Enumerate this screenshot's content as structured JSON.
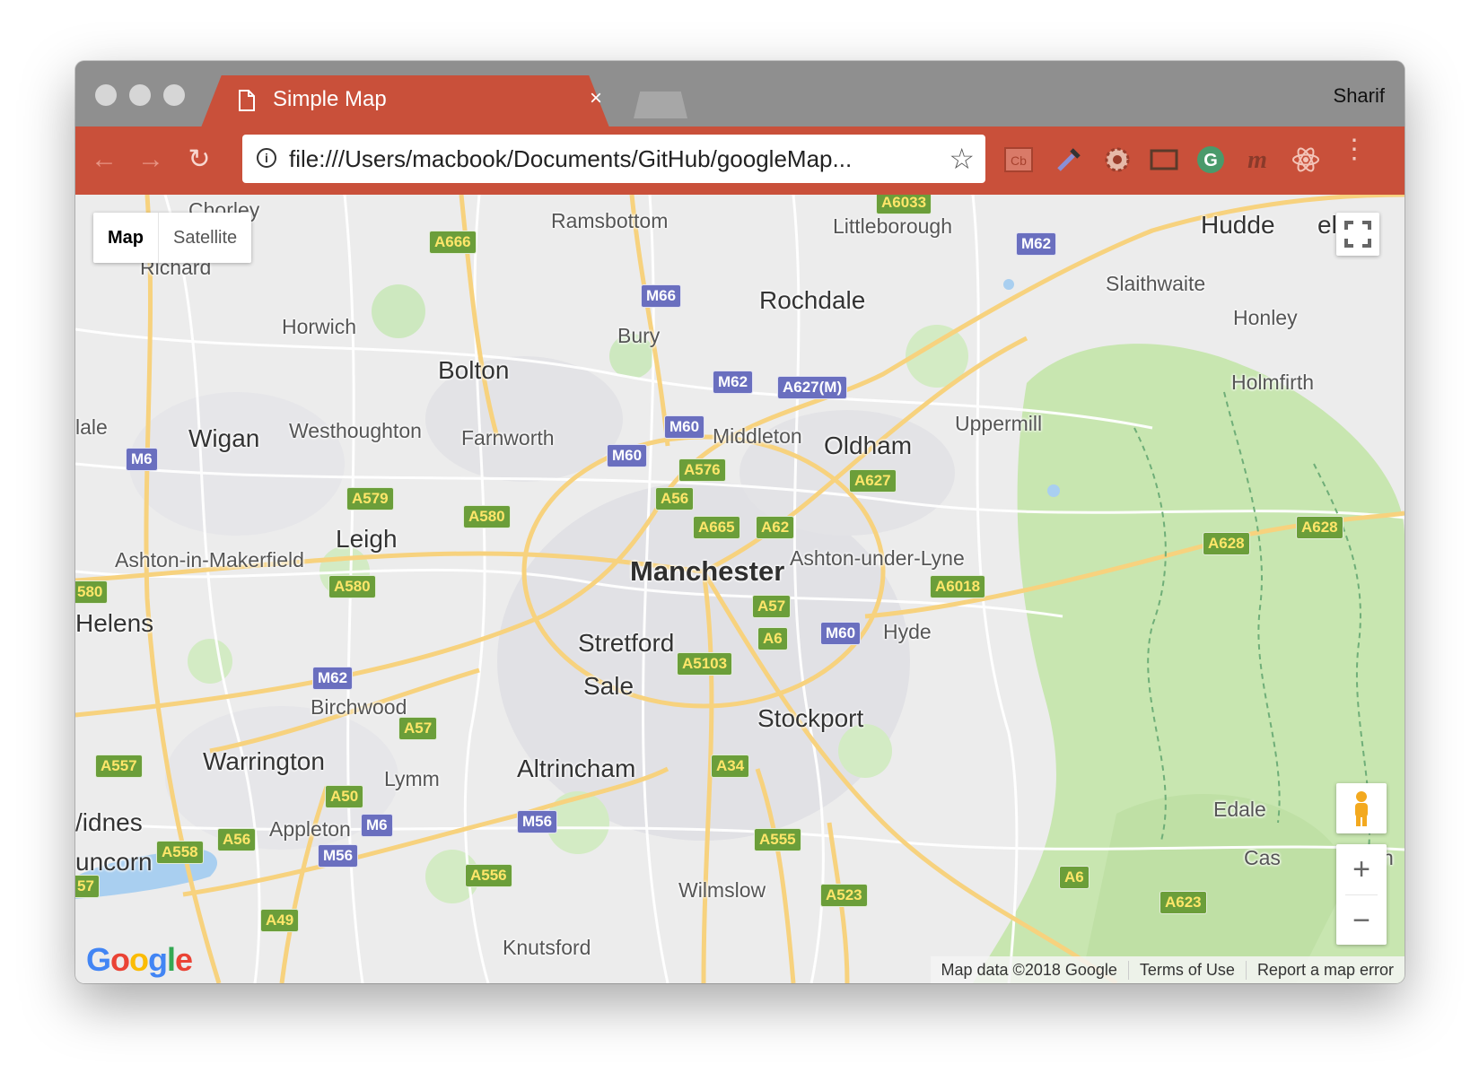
{
  "browser": {
    "tab_title": "Simple Map",
    "tab_close": "×",
    "profile_name": "Sharif",
    "url": "file:///Users/macbook/Documents/GitHub/googleMap...",
    "extensions": [
      "cb-extension-icon",
      "eyedropper-icon",
      "gear-extension-icon",
      "window-resizer-icon",
      "grammarly-icon",
      "m-extension-icon",
      "react-devtools-icon"
    ],
    "accent_color": "#c9503a"
  },
  "map": {
    "type_controls": [
      "Map",
      "Satellite"
    ],
    "selected_type": "Map",
    "zoom_in": "+",
    "zoom_out": "−",
    "logo": "Google",
    "attribution": [
      "Map data ©2018 Google",
      "Terms of Use",
      "Report a map error"
    ],
    "places": {
      "chorley": "Chorley",
      "richard": "Richard",
      "ramsbottom": "Ramsbottom",
      "littleborough": "Littleborough",
      "hudde": "Hudde",
      "el": "el",
      "rochdale": "Rochdale",
      "slaithwaite": "Slaithwaite",
      "horwich": "Horwich",
      "bury": "Bury",
      "honley": "Honley",
      "bolton": "Bolton",
      "holmfirth": "Holmfirth",
      "dale": "lale",
      "wigan": "Wigan",
      "westhoughton": "Westhoughton",
      "farnworth": "Farnworth",
      "middleton": "Middleton",
      "oldham": "Oldham",
      "uppermill": "Uppermill",
      "leigh": "Leigh",
      "ashton_makerfield": "Ashton-in-Makerfield",
      "manchester": "Manchester",
      "ashton_lyne": "Ashton-under-Lyne",
      "helens": "Helens",
      "stretford": "Stretford",
      "hyde": "Hyde",
      "sale": "Sale",
      "birchwood": "Birchwood",
      "stockport": "Stockport",
      "warrington": "Warrington",
      "lymm": "Lymm",
      "altrincham": "Altrincham",
      "widnes": "/idnes",
      "edale": "Edale",
      "appleton": "Appleton",
      "runcorn": "uncorn",
      "castleton": "Cas",
      "castleton_end": "n",
      "wilmslow": "Wilmslow",
      "knutsford": "Knutsford"
    },
    "roads": {
      "a6033": "A6033",
      "a666": "A666",
      "m62_ne": "M62",
      "m66": "M66",
      "m62_n": "M62",
      "a627m": "A627(M)",
      "m60_n": "M60",
      "m6_w": "M6",
      "m60_nw": "M60",
      "a576": "A576",
      "a627": "A627",
      "a579": "A579",
      "a56_n": "A56",
      "a580_c": "A580",
      "a665": "A665",
      "a62": "A62",
      "a628_e": "A628",
      "a628": "A628",
      "a580_w": "A580",
      "a580_l": "580",
      "a6018": "A6018",
      "a57_c": "A57",
      "a6_c": "A6",
      "m60_e": "M60",
      "a5103": "A5103",
      "m62_w": "M62",
      "a57_w": "A57",
      "a557": "A557",
      "a34": "A34",
      "a50": "A50",
      "m56_c": "M56",
      "m6_s": "M6",
      "a555": "A555",
      "a56_s": "A56",
      "a558": "A558",
      "m56_w": "M56",
      "a556": "A556",
      "a6_s": "A6",
      "a57_s": "57",
      "a523": "A523",
      "a623": "A623",
      "a49": "A49"
    }
  }
}
